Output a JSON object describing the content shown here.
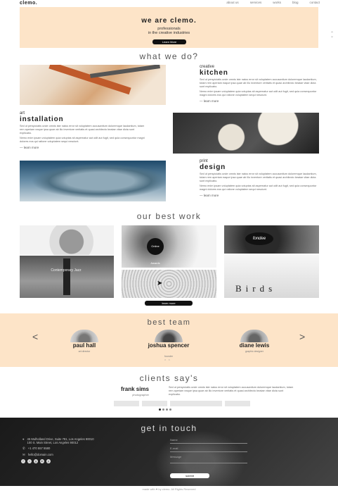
{
  "nav": {
    "logo": "clemo.",
    "items": [
      "about us",
      "services",
      "works",
      "blog",
      "contact"
    ]
  },
  "hero": {
    "title": "we are clemo.",
    "subtitle_line1": "professionals",
    "subtitle_line2": "in the creative industries",
    "button": "Learn More"
  },
  "services": {
    "title": "what we do?",
    "items": [
      {
        "small": "creative",
        "big": "kitchen",
        "p1": "Sed ut perspiciatis unde omnis iste natus error sit voluptatem accusantium doloremque laudantium, totam rem aperiam eaque ipsa quae ab illo inventore veritatis et quasi architecto beatae vitae dicta sunt explicabo.",
        "p2": "Nemo enim ipsam voluptatem quia voluptas sit aspernatur aut odit aut fugit, sed quia consequuntur magni dolores eos qui ratione voluptatem sequi nesciunt.",
        "more": "learn more"
      },
      {
        "small": "art",
        "big": "installation",
        "p1": "Sed ut perspiciatis unde omnis iste natus error sit voluptatem accusantium doloremque laudantium, totam rem aperiam eaque ipsa quae ab illo inventore veritatis et quasi architecto beatae vitae dicta sunt explicabo.",
        "p2": "Nemo enim ipsam voluptatem quia voluptas sit aspernatur aut odit aut fugit, sed quia consequuntur magni dolores eos qui ratione voluptatem sequi nesciunt.",
        "more": "learn more"
      },
      {
        "small": "print",
        "big": "design",
        "p1": "Sed ut perspiciatis unde omnis iste natus error sit voluptatem accusantium doloremque laudantium, totam rem aperiam eaque ipsa quae ab illo inventore veritatis et quasi architecto beatae vitae dicta sunt explicabo.",
        "p2": "Nemo enim ipsam voluptatem quia voluptas sit aspernatur aut odit aut fugit, sed quia consequuntur magni dolores eos qui ratione voluptatem sequi nesciunt.",
        "more": "learn more"
      }
    ]
  },
  "work": {
    "title": "our best work",
    "tile_texts": [
      "Online Awards",
      "Contemporary Jazz",
      "fondee",
      "Birds"
    ],
    "button": "learn more"
  },
  "team": {
    "title": "best team",
    "members": [
      {
        "name": "paul hall",
        "role": "art director"
      },
      {
        "name": "joshua spencer",
        "role": "founder"
      },
      {
        "name": "diane lewis",
        "role": "graphic designer"
      }
    ],
    "prev": "<",
    "next": ">"
  },
  "clients": {
    "title": "clients say's",
    "name": "frank sims",
    "role": "photographer",
    "quote": "Sed ut perspiciatis unde omnis iste natus error sit voluptatem accusantium doloremque laudantium, totam rem aperiam eaque ipsa quae ab illo inventore veritatis et quasi architecto beatae vitae dicta sunt explicabo."
  },
  "contact": {
    "title": "get in touch",
    "address_line1": "45 Mulholland Drive, Suite 791, Los Angeles 90010",
    "address_line2": "100 S. Main Street, Los Angeles 90012",
    "phone": "+1 470 557 5580",
    "email": "hello@domain.com",
    "social": [
      "f",
      "t",
      "g",
      "in",
      "p"
    ],
    "field_name": "Name",
    "field_email": "E-mail",
    "field_message": "Message",
    "submit": "submit"
  },
  "footer": {
    "text": "made with ♥ by clemo. All Rights Reserved"
  }
}
